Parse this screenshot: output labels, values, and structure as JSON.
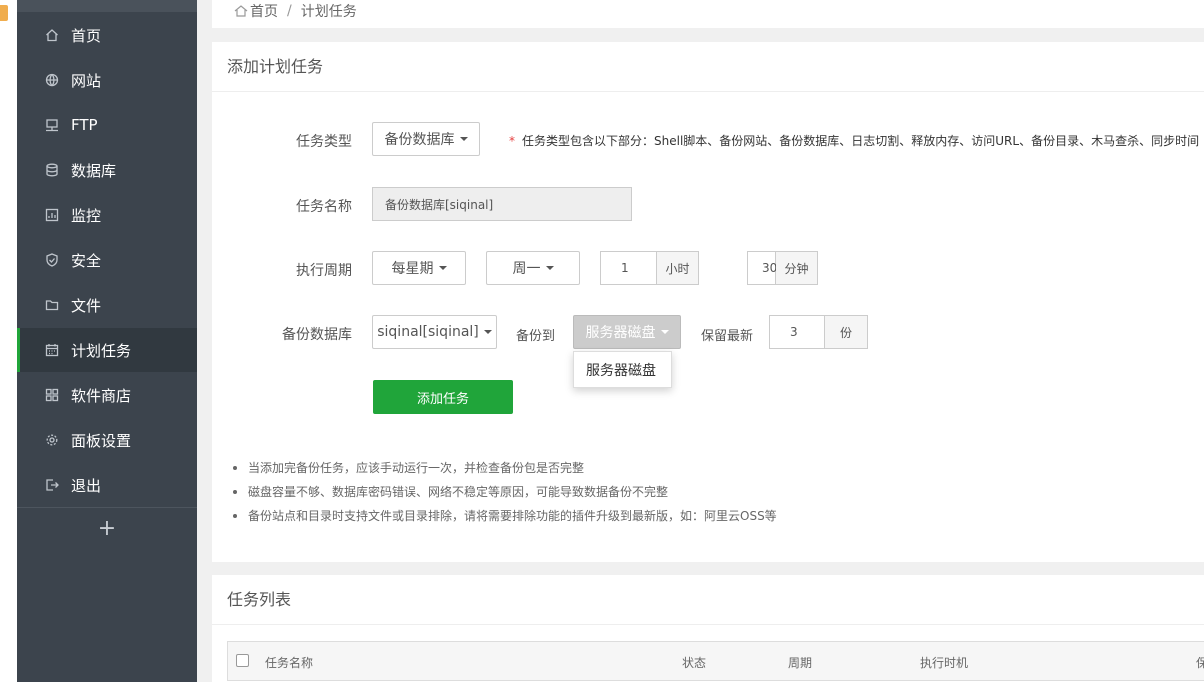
{
  "sidebar": {
    "items": [
      {
        "label": "首页",
        "icon": "home-icon"
      },
      {
        "label": "网站",
        "icon": "globe-icon"
      },
      {
        "label": "FTP",
        "icon": "ftp-server-icon"
      },
      {
        "label": "数据库",
        "icon": "database-icon"
      },
      {
        "label": "监控",
        "icon": "monitor-icon"
      },
      {
        "label": "安全",
        "icon": "shield-icon"
      },
      {
        "label": "文件",
        "icon": "folder-icon"
      },
      {
        "label": "计划任务",
        "icon": "calendar-icon",
        "active": true
      },
      {
        "label": "软件商店",
        "icon": "apps-grid-icon"
      },
      {
        "label": "面板设置",
        "icon": "gear-icon"
      },
      {
        "label": "退出",
        "icon": "logout-icon"
      }
    ],
    "add_symbol": "+"
  },
  "breadcrumb": {
    "home": "首页",
    "separator": "/",
    "current": "计划任务"
  },
  "add_task": {
    "title": "添加计划任务",
    "task_type": {
      "label": "任务类型",
      "value": "备份数据库",
      "hint_star": "*",
      "hint": "任务类型包含以下部分：Shell脚本、备份网站、备份数据库、日志切割、释放内存、访问URL、备份目录、木马查杀、同步时间"
    },
    "task_name": {
      "label": "任务名称",
      "value": "备份数据库[siqinal]"
    },
    "period": {
      "label": "执行周期",
      "cycle": "每星期",
      "weekday": "周一",
      "hour_value": "1",
      "hour_unit": "小时",
      "minute_value": "30",
      "minute_unit": "分钟"
    },
    "backup_db": {
      "label": "备份数据库",
      "database": "siqinal[siqinal]",
      "backup_to_label": "备份到",
      "backup_target": "服务器磁盘",
      "dropdown_option": "服务器磁盘",
      "keep_label": "保留最新",
      "keep_value": "3",
      "keep_unit": "份"
    },
    "submit_label": "添加任务",
    "notes": [
      "当添加完备份任务，应该手动运行一次，并检查备份包是否完整",
      "磁盘容量不够、数据库密码错误、网络不稳定等原因，可能导致数据备份不完整",
      "备份站点和目录时支持文件或目录排除，请将需要排除功能的插件升级到最新版，如：阿里云OSS等"
    ]
  },
  "task_list": {
    "title": "任务列表",
    "columns": [
      "任务名称",
      "状态",
      "周期",
      "执行时机",
      "保"
    ]
  },
  "colors": {
    "sidebar_bg": "#3c444d",
    "accent_green": "#20a53a",
    "active_item_bg": "#313940"
  }
}
